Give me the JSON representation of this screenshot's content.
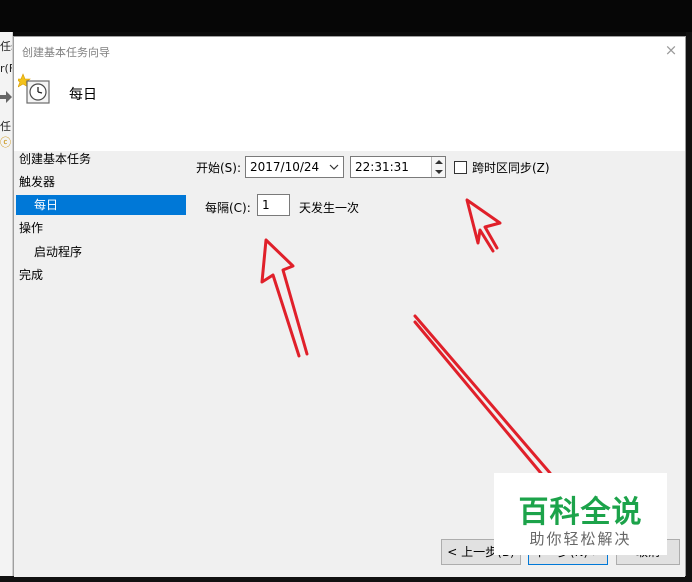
{
  "parent_window": {
    "fragments": [
      "任ś",
      "r(F",
      "任",
      "ⓒ"
    ]
  },
  "dialog": {
    "title": "创建基本任务向导",
    "header_title": "每日",
    "close_glyph": "×"
  },
  "nav": {
    "items": [
      {
        "label": "创建基本任务"
      },
      {
        "label": "触发器"
      },
      {
        "label": "每日"
      },
      {
        "label": "操作"
      },
      {
        "label": "启动程序"
      },
      {
        "label": "完成"
      }
    ]
  },
  "form": {
    "start_label": "开始(S):",
    "start_date": "2017/10/24",
    "start_time": "22:31:31",
    "sync_label": "跨时区同步(Z)",
    "sync_checked": false,
    "recur_label": "每隔(C):",
    "recur_value": "1",
    "recur_suffix": "天发生一次"
  },
  "buttons": {
    "back": "< 上一步(B)",
    "next": "下一步(N) >",
    "cancel": "取消"
  },
  "watermark": {
    "logo": "百科全说",
    "sub": "助你轻松解决"
  },
  "colors": {
    "selection": "#0078d7",
    "annotation_arrow": "#e0202a",
    "watermark_green": "#1ca34a"
  }
}
